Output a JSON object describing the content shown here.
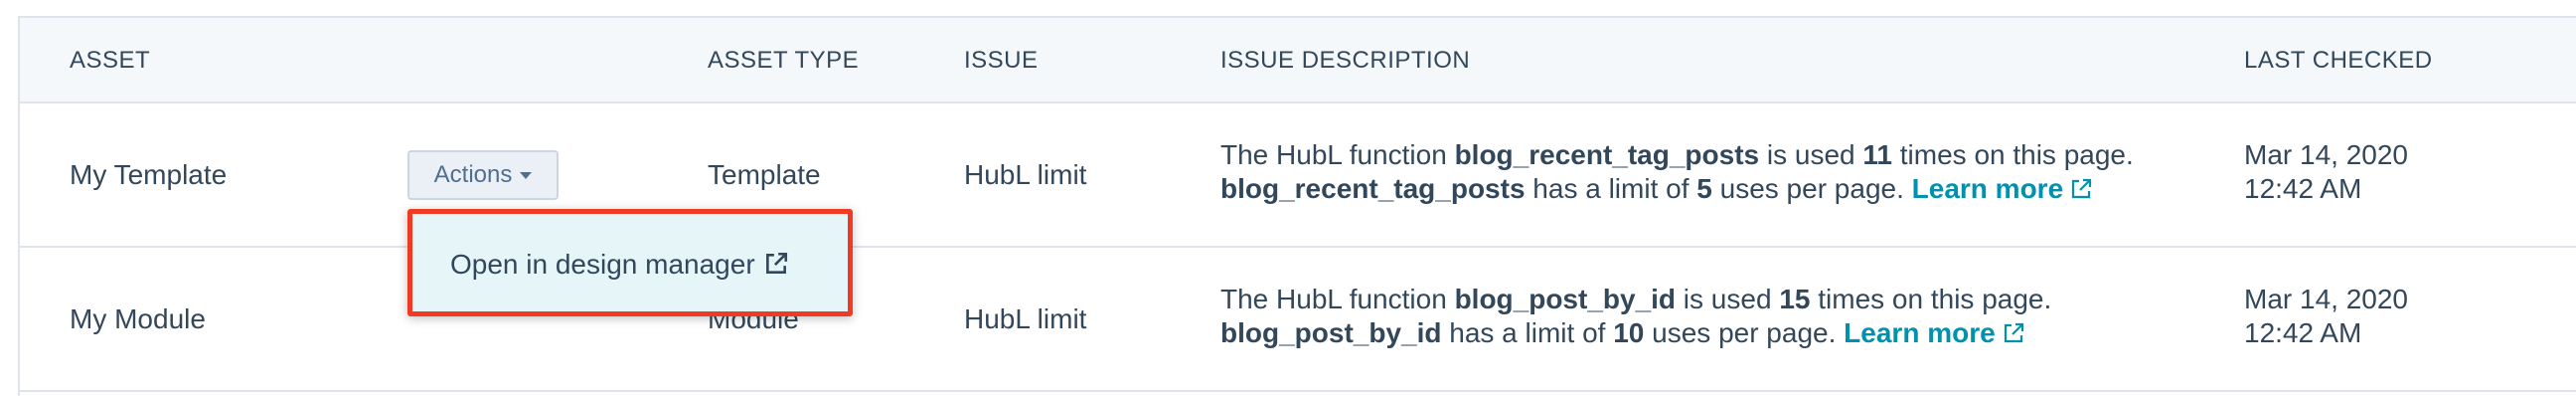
{
  "table": {
    "headers": {
      "asset": "ASSET",
      "asset_type": "ASSET TYPE",
      "issue": "ISSUE",
      "issue_description": "ISSUE DESCRIPTION",
      "last_checked": "LAST CHECKED"
    },
    "rows": [
      {
        "asset": "My Template",
        "actions_label": "Actions",
        "asset_type": "Template",
        "issue": "HubL limit",
        "desc_prefix": "The HubL function ",
        "func_name": "blog_recent_tag_posts",
        "desc_mid": " is used ",
        "used_count": "11",
        "desc_suffix": " times on this page.",
        "func_name_2": "blog_recent_tag_posts",
        "limit_prefix": " has a limit of ",
        "limit_count": "5",
        "limit_suffix": " uses per page. ",
        "learn_more": "Learn more",
        "date": "Mar 14, 2020",
        "time": "12:42 AM"
      },
      {
        "asset": "My Module",
        "asset_type": "Module",
        "issue": "HubL limit",
        "desc_prefix": "The HubL function ",
        "func_name": "blog_post_by_id",
        "desc_mid": " is used ",
        "used_count": "15",
        "desc_suffix": " times on this page.",
        "func_name_2": "blog_post_by_id",
        "limit_prefix": " has a limit of ",
        "limit_count": "10",
        "limit_suffix": " uses per page. ",
        "learn_more": "Learn more",
        "date": "Mar 14, 2020",
        "time": "12:42 AM"
      }
    ]
  },
  "dropdown": {
    "item_label": "Open in design manager",
    "icon": "external-link-icon",
    "highlight_color": "#ef3b24"
  },
  "colors": {
    "header_bg": "#f5f8fa",
    "link": "#0091ae",
    "text": "#33475b",
    "button_bg": "#eaf0f6",
    "dropdown_bg": "#e5f5f8"
  }
}
